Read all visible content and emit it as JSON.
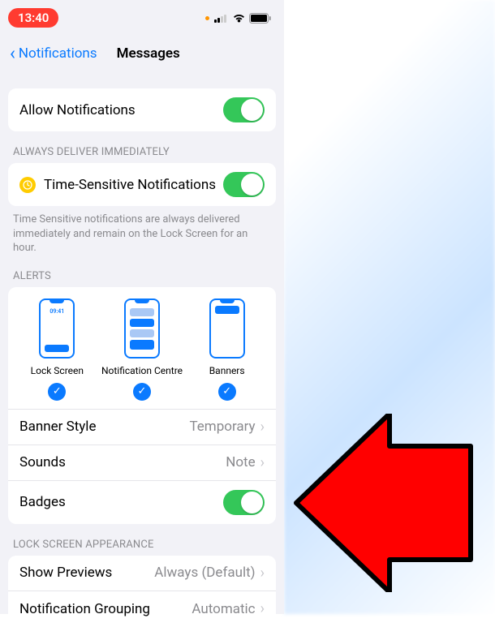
{
  "status": {
    "time": "13:40"
  },
  "nav": {
    "back": "Notifications",
    "title": "Messages"
  },
  "allow": {
    "label": "Allow Notifications",
    "on": true
  },
  "deliver": {
    "header": "ALWAYS DELIVER IMMEDIATELY",
    "ts_label": "Time-Sensitive Notifications",
    "ts_on": true,
    "footer": "Time Sensitive notifications are always delivered immediately and remain on the Lock Screen for an hour."
  },
  "alerts": {
    "header": "ALERTS",
    "lock_time": "09:41",
    "items": [
      {
        "label": "Lock Screen",
        "checked": true
      },
      {
        "label": "Notification Centre",
        "checked": true
      },
      {
        "label": "Banners",
        "checked": true
      }
    ],
    "banner_style": {
      "label": "Banner Style",
      "value": "Temporary"
    },
    "sounds": {
      "label": "Sounds",
      "value": "Note"
    },
    "badges": {
      "label": "Badges",
      "on": true
    }
  },
  "lock_appearance": {
    "header": "LOCK SCREEN APPEARANCE",
    "previews": {
      "label": "Show Previews",
      "value": "Always (Default)"
    },
    "grouping": {
      "label": "Notification Grouping",
      "value": "Automatic"
    }
  }
}
